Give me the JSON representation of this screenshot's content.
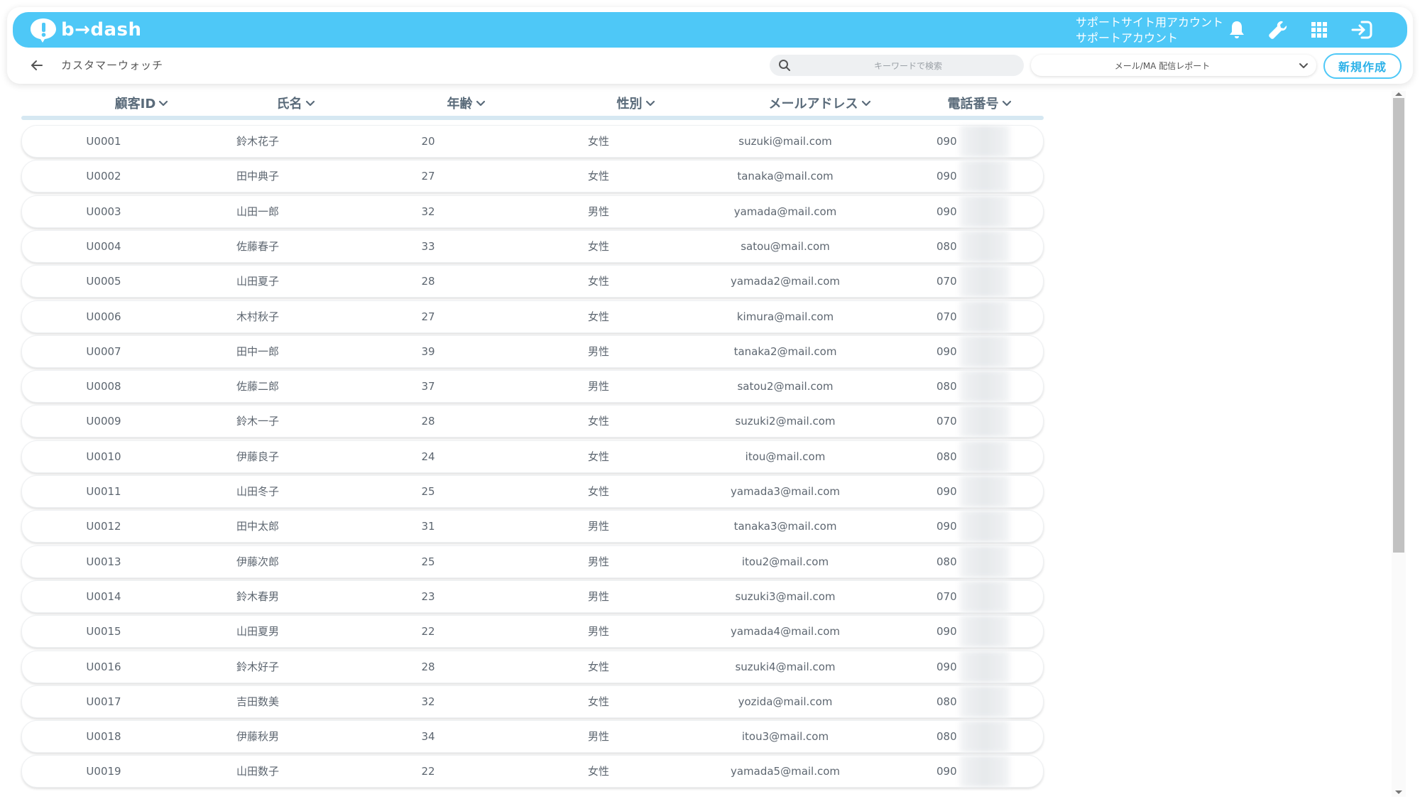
{
  "header": {
    "logo_text": "b→dash",
    "account_line1": "サポートサイト用アカウント",
    "account_line2": "サポートアカウント",
    "brand_color": "#4ec8f7"
  },
  "subbar": {
    "title": "カスタマーウォッチ",
    "search_placeholder": "キーワードで検索",
    "select_value": "メール/MA 配信レポート",
    "new_button": "新規作成"
  },
  "table": {
    "columns": [
      "顧客ID",
      "氏名",
      "年齢",
      "性別",
      "メールアドレス",
      "電話番号"
    ],
    "rows": [
      [
        "U0001",
        "鈴木花子",
        "20",
        "女性",
        "suzuki@mail.com",
        "090"
      ],
      [
        "U0002",
        "田中典子",
        "27",
        "女性",
        "tanaka@mail.com",
        "090"
      ],
      [
        "U0003",
        "山田一郎",
        "32",
        "男性",
        "yamada@mail.com",
        "090"
      ],
      [
        "U0004",
        "佐藤春子",
        "33",
        "女性",
        "satou@mail.com",
        "080"
      ],
      [
        "U0005",
        "山田夏子",
        "28",
        "女性",
        "yamada2@mail.com",
        "070"
      ],
      [
        "U0006",
        "木村秋子",
        "27",
        "女性",
        "kimura@mail.com",
        "070"
      ],
      [
        "U0007",
        "田中一郎",
        "39",
        "男性",
        "tanaka2@mail.com",
        "090"
      ],
      [
        "U0008",
        "佐藤二郎",
        "37",
        "男性",
        "satou2@mail.com",
        "080"
      ],
      [
        "U0009",
        "鈴木一子",
        "28",
        "女性",
        "suzuki2@mail.com",
        "070"
      ],
      [
        "U0010",
        "伊藤良子",
        "24",
        "女性",
        "itou@mail.com",
        "080"
      ],
      [
        "U0011",
        "山田冬子",
        "25",
        "女性",
        "yamada3@mail.com",
        "090"
      ],
      [
        "U0012",
        "田中太郎",
        "31",
        "男性",
        "tanaka3@mail.com",
        "090"
      ],
      [
        "U0013",
        "伊藤次郎",
        "25",
        "男性",
        "itou2@mail.com",
        "080"
      ],
      [
        "U0014",
        "鈴木春男",
        "23",
        "男性",
        "suzuki3@mail.com",
        "070"
      ],
      [
        "U0015",
        "山田夏男",
        "22",
        "男性",
        "yamada4@mail.com",
        "090"
      ],
      [
        "U0016",
        "鈴木好子",
        "28",
        "女性",
        "suzuki4@mail.com",
        "090"
      ],
      [
        "U0017",
        "吉田数美",
        "32",
        "女性",
        "yozida@mail.com",
        "080"
      ],
      [
        "U0018",
        "伊藤秋男",
        "34",
        "男性",
        "itou3@mail.com",
        "080"
      ],
      [
        "U0019",
        "山田数子",
        "22",
        "女性",
        "yamada5@mail.com",
        "090"
      ]
    ]
  }
}
